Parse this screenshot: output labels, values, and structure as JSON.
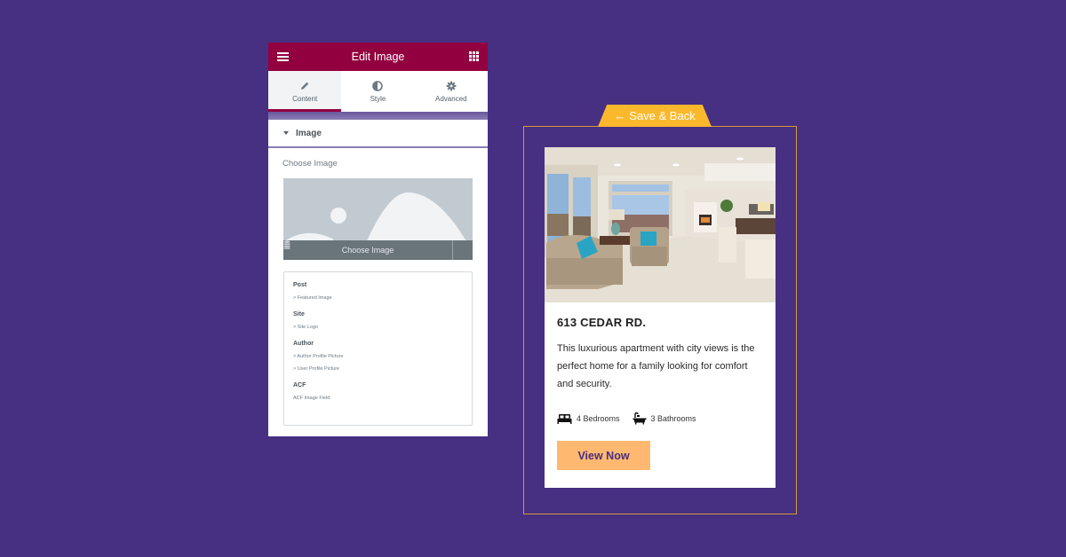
{
  "editor": {
    "title": "Edit Image",
    "menu_icon": "hamburger-icon",
    "apps_icon": "grid-icon",
    "tabs": [
      {
        "label": "Content",
        "icon": "pencil-icon",
        "active": true
      },
      {
        "label": "Style",
        "icon": "half-circle-icon",
        "active": false
      },
      {
        "label": "Advanced",
        "icon": "gear-icon",
        "active": false
      }
    ],
    "section": {
      "title": "Image",
      "expanded": true
    },
    "field_label": "Choose Image",
    "media": {
      "button_label": "Choose Image",
      "library_icon": "database-icon"
    },
    "dynamic_tags": [
      {
        "group": "Post",
        "items": [
          "> Featured Image"
        ]
      },
      {
        "group": "Site",
        "items": [
          "> Site Logo"
        ]
      },
      {
        "group": "Author",
        "items": [
          "> Author Profile Picture",
          "> User Profile Picture"
        ]
      },
      {
        "group": "ACF",
        "items": [
          "ACF Image Field"
        ]
      }
    ]
  },
  "preview": {
    "save_back": {
      "arrow": "←",
      "label": "Save & Back"
    },
    "card": {
      "title": "613 CEDAR RD.",
      "description": "This luxurious apartment with city views is the perfect home for a family looking for comfort and security.",
      "features": [
        {
          "icon": "bed-icon",
          "label": "4 Bedrooms"
        },
        {
          "icon": "bathtub-icon",
          "label": "3 Bathrooms"
        }
      ],
      "cta_label": "View Now"
    }
  },
  "colors": {
    "background": "#472f82",
    "editor_header": "#93003f",
    "save_tab": "#fbb82c",
    "frame_border": "#d49a3e",
    "cta_bg": "#ffb870",
    "cta_text": "#472f82"
  }
}
